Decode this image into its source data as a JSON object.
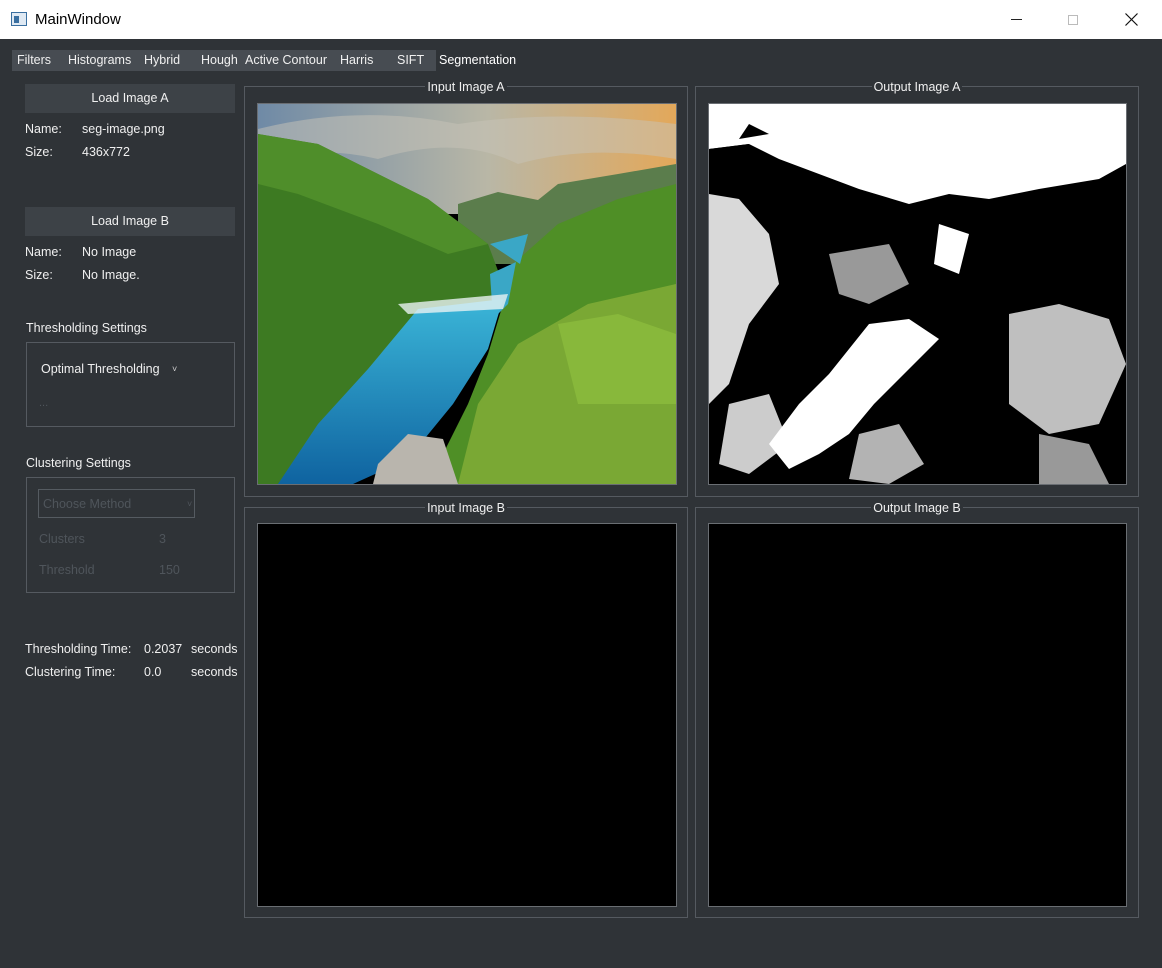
{
  "window": {
    "title": "MainWindow"
  },
  "tabs": [
    {
      "label": "Filters"
    },
    {
      "label": "Histograms"
    },
    {
      "label": "Hybrid"
    },
    {
      "label": "Hough"
    },
    {
      "label": "Active Contour"
    },
    {
      "label": "Harris"
    },
    {
      "label": "SIFT"
    },
    {
      "label": "Segmentation",
      "active": true
    }
  ],
  "sidebar": {
    "image_a": {
      "button": "Load Image A",
      "name_label": "Name:",
      "name_value": "seg-image.png",
      "size_label": "Size:",
      "size_value": "436x772"
    },
    "image_b": {
      "button": "Load Image B",
      "name_label": "Name:",
      "name_value": "No Image",
      "size_label": "Size:",
      "size_value": "No Image."
    },
    "thresholding": {
      "heading": "Thresholding Settings",
      "method": "Optimal Thresholding",
      "extra": "..."
    },
    "clustering": {
      "heading": "Clustering Settings",
      "method_placeholder": "Choose Method",
      "clusters_label": "Clusters",
      "clusters_value": "3",
      "threshold_label": "Threshold",
      "threshold_value": "150"
    },
    "timing": {
      "thresholding_label": "Thresholding Time:",
      "thresholding_value": "0.2037",
      "thresholding_unit": "seconds",
      "clustering_label": "Clustering Time:",
      "clustering_value": "0.0",
      "clustering_unit": "seconds"
    }
  },
  "panels": {
    "input_a": "Input Image A",
    "output_a": "Output Image A",
    "input_b": "Input Image B",
    "output_b": "Output Image B"
  }
}
